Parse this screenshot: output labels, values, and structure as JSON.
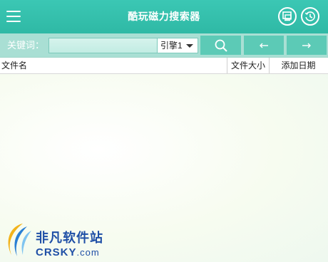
{
  "window": {
    "title": "酷玩磁力搜索器"
  },
  "search": {
    "keyword_label": "关键词：",
    "keyword_value": "",
    "engine_selected": "引擎1"
  },
  "columns": {
    "name": "文件名",
    "size": "文件大小",
    "date": "添加日期"
  },
  "rows": [],
  "watermark": {
    "cn_text": "非凡软件站",
    "en_text": "CRSKY",
    "en_suffix": ".com"
  },
  "colors": {
    "titlebar": "#35c0ad",
    "searchbar": "#a9dfd4",
    "tool_button": "#5ccab6",
    "watermark_blue": "#1f4fa6"
  },
  "icons": {
    "menu": "hamburger-icon",
    "restore": "window-restore-icon",
    "history": "history-clock-icon",
    "search": "search-icon",
    "back": "arrow-left-icon",
    "forward": "arrow-right-icon"
  }
}
